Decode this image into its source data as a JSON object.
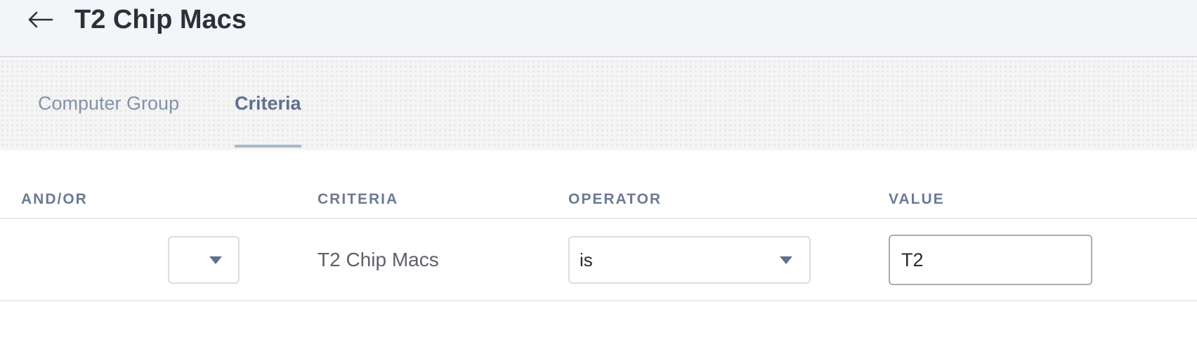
{
  "header": {
    "back_icon": "arrow-left-icon",
    "title": "T2 Chip Macs"
  },
  "tabs": [
    {
      "label": "Computer Group",
      "active": false
    },
    {
      "label": "Criteria",
      "active": true
    }
  ],
  "table": {
    "columns": [
      "AND/OR",
      "CRITERIA",
      "OPERATOR",
      "VALUE"
    ],
    "rows": [
      {
        "and_or": "",
        "criteria": "T2 Chip Macs",
        "operator": "is",
        "value": "T2"
      }
    ]
  },
  "colors": {
    "header_bg": "#f4f5f8",
    "active_tab_text": "#5f6f8e",
    "inactive_tab_text": "#8391a8",
    "tab_underline": "#a8b8d0",
    "column_header_text": "#6c7a93"
  }
}
